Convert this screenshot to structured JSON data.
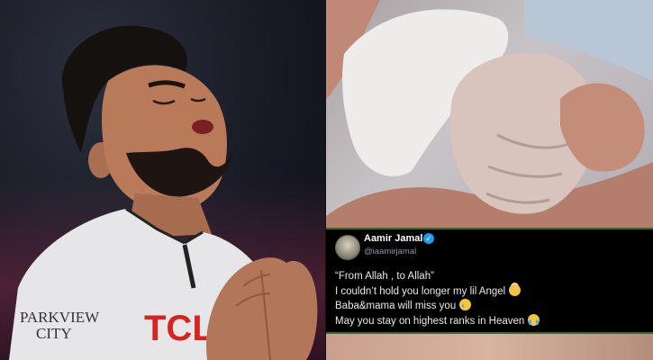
{
  "left_photo": {
    "jersey_sponsor": "TCL",
    "jersey_badge": "PARKVIEW\nCITY"
  },
  "tweet": {
    "author_name": "Aamir Jamal",
    "author_handle": "@iaamirjamal",
    "line1": "“From Allah , to Allah”",
    "line2": "I couldn’t hold you longer my lil Angel",
    "line3": "Baba&mama will miss you",
    "line4": "May you stay on highest ranks in Heaven",
    "verified_color": "#1d9bf0",
    "border_color": "#3b6b18"
  }
}
